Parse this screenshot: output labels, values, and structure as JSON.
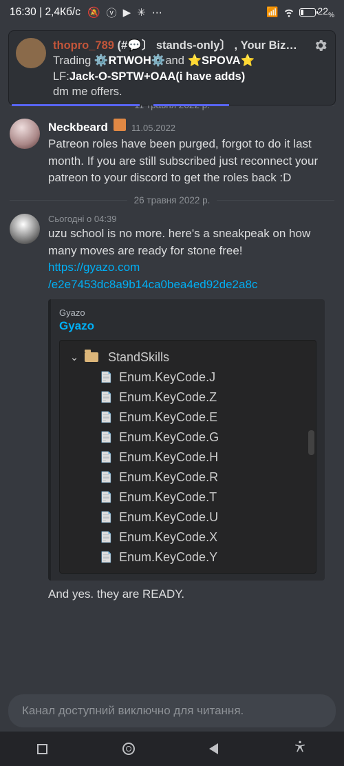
{
  "status": {
    "time": "16:30",
    "net": "2,4Кб/с",
    "battery_pct": "22",
    "battery_suffix": "%"
  },
  "reply": {
    "user": "thopro_789",
    "channels": "(#💬〕 stands-only〕 , Your Biz…",
    "line2_pre": "Trading ",
    "line2_bold1": "⚙️RTWOH⚙️",
    "line2_mid": "and ",
    "line2_bold2": "⭐SPOVA⭐",
    "line3_pre": "LF:",
    "line3_bold": "Jack-O-SPTW+OAA(i have adds)",
    "line4": "dm me offers."
  },
  "dividers": {
    "d1": "11 травня 2022 р.",
    "d2": "26 травня 2022 р."
  },
  "msg1": {
    "author": "Neckbeard",
    "date": "11.05.2022",
    "text": "Patreon roles have been purged, forgot to do it last month. If you are still subscribed just reconnect your patreon to your discord to get the roles back :D"
  },
  "msg2": {
    "date": "Сьогодні о 04:39",
    "text": "uzu school is no more. here's a sneakpeak on how many moves are ready for stone free!",
    "link": "https://gyazo.com/e2e7453dc8a9b14ca0bea4ed92de2a8c",
    "link_display_1": "https://gyazo.com",
    "link_display_2": "/e2e7453dc8a9b14ca0bea4ed92de2a8c"
  },
  "embed": {
    "provider": "Gyazo",
    "title": "Gyazo",
    "folder": "StandSkills",
    "items": [
      "Enum.KeyCode.J",
      "Enum.KeyCode.Z",
      "Enum.KeyCode.E",
      "Enum.KeyCode.G",
      "Enum.KeyCode.H",
      "Enum.KeyCode.R",
      "Enum.KeyCode.T",
      "Enum.KeyCode.U",
      "Enum.KeyCode.X",
      "Enum.KeyCode.Y"
    ]
  },
  "msg3": {
    "text": "And yes. they are READY."
  },
  "input": {
    "placeholder": "Канал доступний виключно для читання."
  }
}
